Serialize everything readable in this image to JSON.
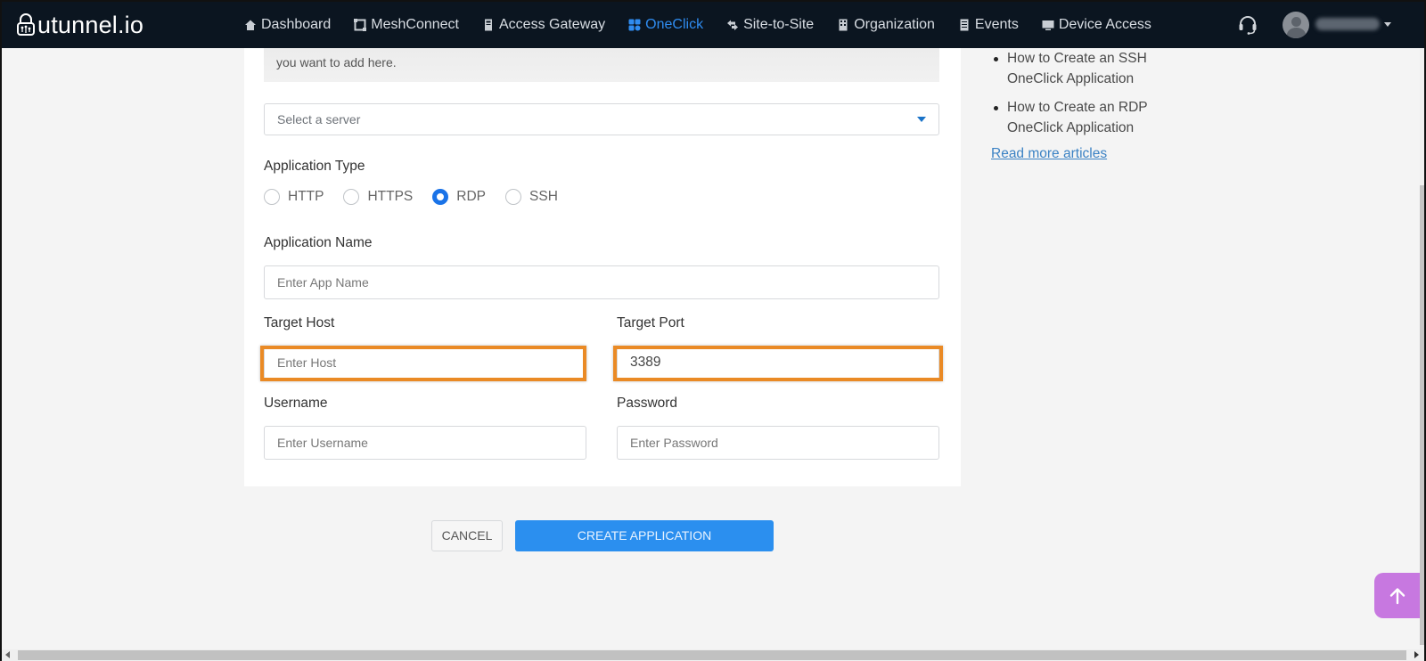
{
  "brand": {
    "name": "utunnel.io"
  },
  "nav": {
    "items": [
      {
        "label": "Dashboard",
        "icon": "home-icon",
        "active": false
      },
      {
        "label": "MeshConnect",
        "icon": "mesh-icon",
        "active": false
      },
      {
        "label": "Access Gateway",
        "icon": "server-icon",
        "active": false
      },
      {
        "label": "OneClick",
        "icon": "grid-icon",
        "active": true
      },
      {
        "label": "Site-to-Site",
        "icon": "arrows-icon",
        "active": false
      },
      {
        "label": "Organization",
        "icon": "building-icon",
        "active": false
      },
      {
        "label": "Events",
        "icon": "list-icon",
        "active": false
      },
      {
        "label": "Device Access",
        "icon": "monitor-icon",
        "active": false
      }
    ],
    "support_icon": "headset-icon",
    "user_menu_icon": "chevron-down-icon"
  },
  "form": {
    "info_text": "you want to add here.",
    "server_select": {
      "placeholder": "Select a server"
    },
    "app_type": {
      "label": "Application Type",
      "options": [
        "HTTP",
        "HTTPS",
        "RDP",
        "SSH"
      ],
      "selected": "RDP"
    },
    "app_name": {
      "label": "Application Name",
      "placeholder": "Enter App Name",
      "value": ""
    },
    "target_host": {
      "label": "Target Host",
      "placeholder": "Enter Host",
      "value": ""
    },
    "target_port": {
      "label": "Target Port",
      "placeholder": "",
      "value": "3389"
    },
    "username": {
      "label": "Username",
      "placeholder": "Enter Username",
      "value": ""
    },
    "password": {
      "label": "Password",
      "placeholder": "Enter Password",
      "value": ""
    },
    "highlight_color": "#ea8a25"
  },
  "actions": {
    "cancel_label": "CANCEL",
    "create_label": "CREATE APPLICATION",
    "create_color": "#2b8fef"
  },
  "help": {
    "articles": [
      "How to Create an SSH OneClick Application",
      "How to Create an RDP OneClick Application"
    ],
    "read_more": "Read more articles"
  },
  "colors": {
    "navbar_bg": "#0b1520",
    "accent": "#2f8cf0",
    "scroll_top_bg": "#c778e0"
  }
}
